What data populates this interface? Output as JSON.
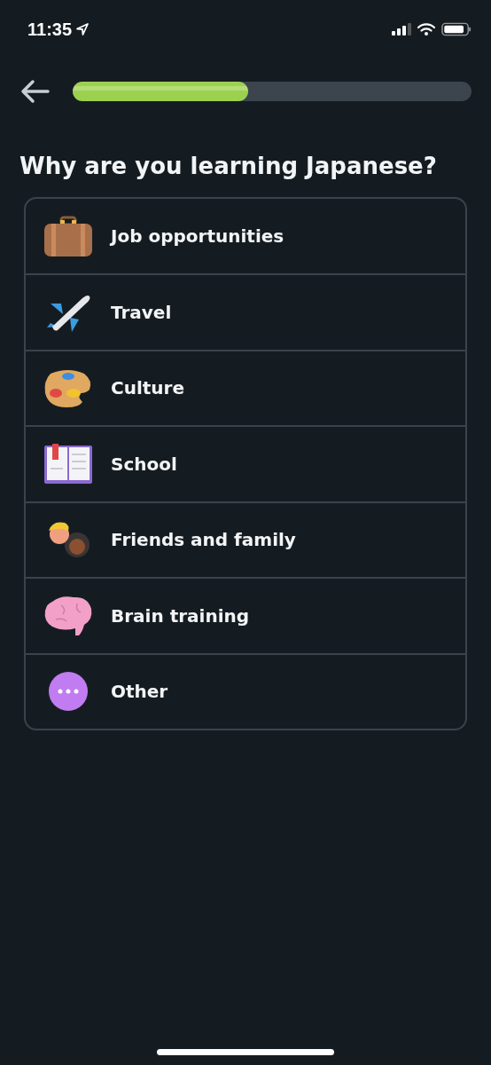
{
  "status_bar": {
    "time": "11:35"
  },
  "progress": {
    "level": 0.44
  },
  "title": "Why are you learning Japanese?",
  "options": [
    {
      "kind": "job",
      "label": "Job opportunities"
    },
    {
      "kind": "travel",
      "label": "Travel"
    },
    {
      "kind": "culture",
      "label": "Culture"
    },
    {
      "kind": "school",
      "label": "School"
    },
    {
      "kind": "friends",
      "label": "Friends and family"
    },
    {
      "kind": "brain",
      "label": "Brain training"
    },
    {
      "kind": "other",
      "label": "Other"
    }
  ]
}
